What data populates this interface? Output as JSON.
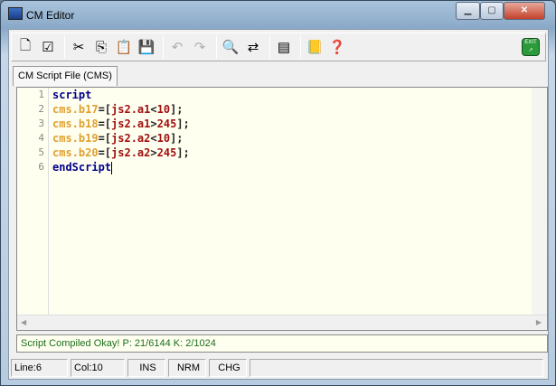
{
  "window": {
    "title": "CM Editor",
    "minimize": "▁",
    "maximize": "▢",
    "close": "✕"
  },
  "toolbar": {
    "buttons": [
      {
        "name": "new-file-icon",
        "glyph": "🗋"
      },
      {
        "name": "compile-icon",
        "glyph": "☑"
      },
      {
        "sep": true
      },
      {
        "name": "cut-icon",
        "glyph": "✂"
      },
      {
        "name": "copy-icon",
        "glyph": "⎘"
      },
      {
        "name": "paste-icon",
        "glyph": "📋"
      },
      {
        "name": "save-icon",
        "glyph": "💾"
      },
      {
        "sep": true
      },
      {
        "name": "undo-icon",
        "glyph": "↶",
        "disabled": true
      },
      {
        "name": "redo-icon",
        "glyph": "↷",
        "disabled": true
      },
      {
        "sep": true
      },
      {
        "name": "find-icon",
        "glyph": "🔍"
      },
      {
        "name": "replace-icon",
        "glyph": "⇄"
      },
      {
        "sep": true
      },
      {
        "name": "view-icon",
        "glyph": "▤"
      },
      {
        "sep": true
      },
      {
        "name": "help-book-icon",
        "glyph": "📒"
      },
      {
        "name": "context-help-icon",
        "glyph": "❓"
      }
    ],
    "exit_label": "EXIT ↗"
  },
  "tab": {
    "label": "CM Script File (CMS)"
  },
  "editor": {
    "line_numbers": [
      "1",
      "2",
      "3",
      "4",
      "5",
      "6"
    ],
    "lines": [
      [
        {
          "t": "script",
          "c": "kw"
        }
      ],
      [
        {
          "t": "cms.b17",
          "c": "id"
        },
        {
          "t": "=[",
          "c": "op"
        },
        {
          "t": "js2.a1",
          "c": "ref"
        },
        {
          "t": "<",
          "c": "op"
        },
        {
          "t": "10",
          "c": "ref"
        },
        {
          "t": "];",
          "c": "op"
        }
      ],
      [
        {
          "t": "cms.b18",
          "c": "id"
        },
        {
          "t": "=[",
          "c": "op"
        },
        {
          "t": "js2.a1",
          "c": "ref"
        },
        {
          "t": ">",
          "c": "op"
        },
        {
          "t": "245",
          "c": "ref"
        },
        {
          "t": "];",
          "c": "op"
        }
      ],
      [
        {
          "t": "cms.b19",
          "c": "id"
        },
        {
          "t": "=[",
          "c": "op"
        },
        {
          "t": "js2.a2",
          "c": "ref"
        },
        {
          "t": "<",
          "c": "op"
        },
        {
          "t": "10",
          "c": "ref"
        },
        {
          "t": "];",
          "c": "op"
        }
      ],
      [
        {
          "t": "cms.b20",
          "c": "id"
        },
        {
          "t": "=[",
          "c": "op"
        },
        {
          "t": "js2.a2",
          "c": "ref"
        },
        {
          "t": ">",
          "c": "op"
        },
        {
          "t": "245",
          "c": "ref"
        },
        {
          "t": "];",
          "c": "op"
        }
      ],
      [
        {
          "t": "endScript",
          "c": "kw"
        }
      ]
    ]
  },
  "message": "Script Compiled Okay!  P: 21/6144  K: 2/1024",
  "statusbar": {
    "line": "Line:6",
    "col": "Col:10",
    "ins": "INS",
    "nrm": "NRM",
    "chg": "CHG"
  }
}
